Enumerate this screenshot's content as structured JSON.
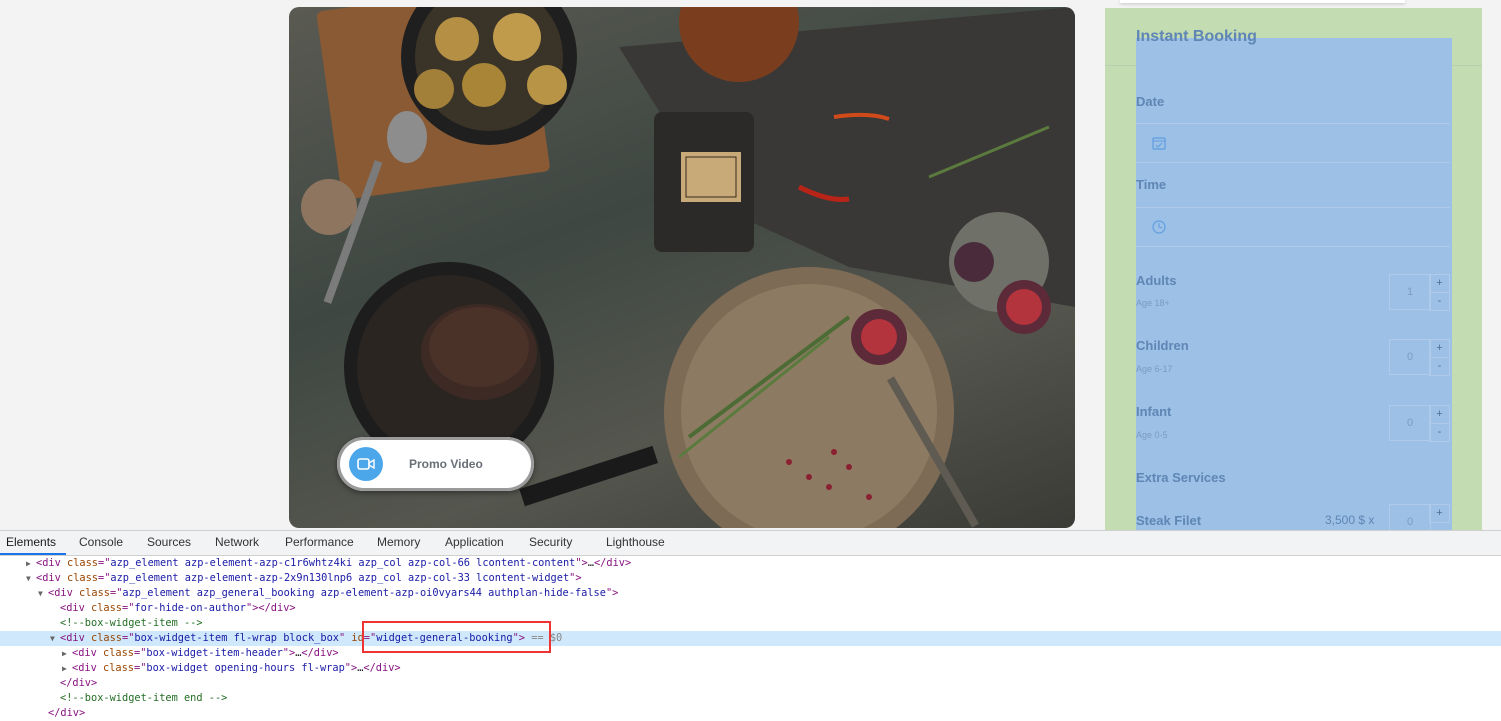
{
  "page": {
    "promo": {
      "label": "Promo Video",
      "icon": "video-camera-icon"
    },
    "widget": {
      "title": "Instant Booking",
      "date_label": "Date",
      "time_label": "Time",
      "adults": {
        "label": "Adults",
        "sub": "Age 18+",
        "value": "1",
        "plus": "+",
        "minus": "-"
      },
      "children": {
        "label": "Children",
        "sub": "Age 6-17",
        "value": "0",
        "plus": "+",
        "minus": "-"
      },
      "infant": {
        "label": "Infant",
        "sub": "Age 0-5",
        "value": "0",
        "plus": "+",
        "minus": "-"
      },
      "extra_label": "Extra Services",
      "steak": {
        "label": "Steak Filet",
        "price": "3,500 $ x",
        "value": "0",
        "plus": "+"
      }
    }
  },
  "devtools": {
    "tabs": [
      "Elements",
      "Console",
      "Sources",
      "Network",
      "Performance",
      "Memory",
      "Application",
      "Security",
      "Lighthouse"
    ],
    "active_tab": "Elements",
    "lines": {
      "l1_class": "azp_element azp-element-azp-c1r6whtz4ki azp_col azp-col-66 lcontent-content",
      "l2_class": "azp_element azp-element-azp-2x9n130lnp6 azp_col azp-col-33 lcontent-widget",
      "l3_class": "azp_element azp_general_booking azp-element-azp-oi0vyars44 authplan-hide-false",
      "l4_class": "for-hide-on-author",
      "l5_comment": "<!--box-widget-item -->",
      "l6_class": "box-widget-item fl-wrap block_box",
      "l6_id": "widget-general-booking",
      "l6_suffix": "$0",
      "l7_class": "box-widget-item-header",
      "l8_class": "box-widget opening-hours fl-wrap",
      "l9_close": "</div>",
      "l10_comment": "<!--box-widget-item end -->",
      "l11_close": "</div>"
    }
  }
}
